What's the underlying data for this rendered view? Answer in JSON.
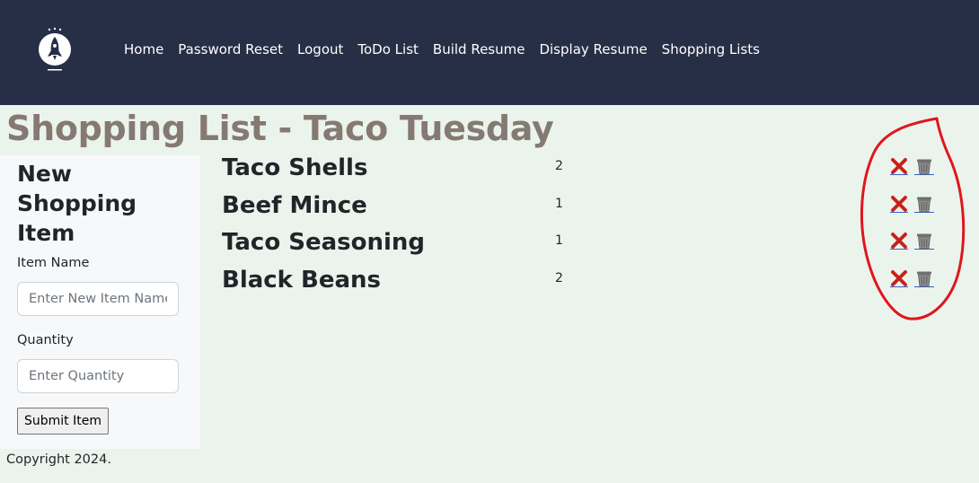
{
  "navbar": {
    "brand_icon": "rocket-logo",
    "links": [
      "Home",
      "Password Reset",
      "Logout",
      "ToDo List",
      "Build Resume",
      "Display Resume",
      "Shopping Lists"
    ]
  },
  "page": {
    "title": "Shopping List - Taco Tuesday"
  },
  "form": {
    "heading": "New Shopping Item",
    "item_name_label": "Item Name",
    "item_name_placeholder": "Enter New Item Name",
    "item_name_value": "",
    "quantity_label": "Quantity",
    "quantity_placeholder": "Enter Quantity",
    "quantity_value": "",
    "submit_label": "Submit Item"
  },
  "items": [
    {
      "name": "Taco Shells",
      "quantity": "2"
    },
    {
      "name": "Beef Mince",
      "quantity": "1"
    },
    {
      "name": "Taco Seasoning",
      "quantity": "1"
    },
    {
      "name": "Black Beans",
      "quantity": "2"
    }
  ],
  "icons": {
    "remove": "red-x-icon",
    "delete": "trash-can-icon"
  },
  "colors": {
    "navbar_bg": "#262f45",
    "page_bg": "#ebf4ec",
    "title_color": "#857a72",
    "annotation_red": "#e0161d"
  },
  "footer": {
    "copyright": "Copyright 2024."
  }
}
